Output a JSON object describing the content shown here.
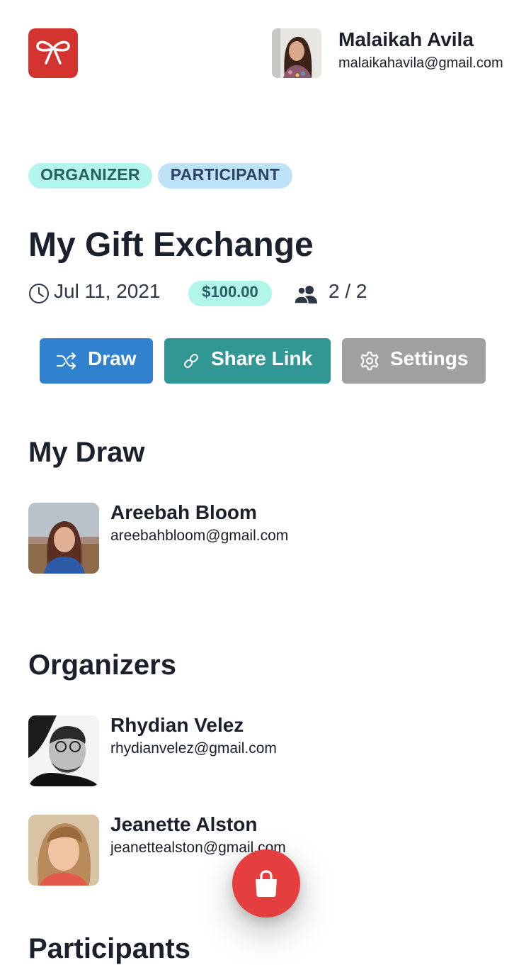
{
  "header": {
    "user_name": "Malaikah Avila",
    "user_email": "malaikahavila@gmail.com"
  },
  "badges": [
    "ORGANIZER",
    "PARTICIPANT"
  ],
  "exchange": {
    "title": "My Gift Exchange",
    "date": "Jul 11, 2021",
    "budget": "$100.00",
    "participants_count": "2 / 2"
  },
  "actions": {
    "draw_label": "Draw",
    "share_label": "Share Link",
    "settings_label": "Settings"
  },
  "my_draw": {
    "heading": "My Draw",
    "person": {
      "name": "Areebah Bloom",
      "email": "areebahbloom@gmail.com"
    }
  },
  "organizers": {
    "heading": "Organizers",
    "people": [
      {
        "name": "Rhydian Velez",
        "email": "rhydianvelez@gmail.com"
      },
      {
        "name": "Jeanette Alston",
        "email": "jeanettealston@gmail.com"
      }
    ]
  },
  "next_section_heading": "Participants",
  "colors": {
    "logo": "#d3342f",
    "organizer_badge": "#b2f5ea",
    "participant_badge": "#bee3f8",
    "draw_button": "#3182ce",
    "share_button": "#319795",
    "settings_button": "#a0a0a0",
    "fab": "#e53e3e"
  },
  "icons": {
    "logo": "ribbon-bow-icon",
    "date": "clock-icon",
    "participants": "users-icon",
    "draw": "shuffle-icon",
    "share": "link-icon",
    "settings": "gear-icon",
    "fab": "shopping-bag-icon"
  }
}
